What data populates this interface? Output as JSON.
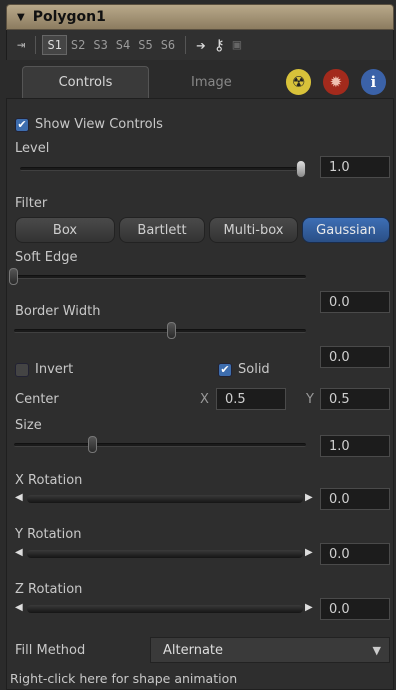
{
  "title": "Polygon1",
  "toolbar": {
    "slots": [
      "S1",
      "S2",
      "S3",
      "S4",
      "S5",
      "S6"
    ],
    "active_slot": "S1"
  },
  "tabs": {
    "controls": "Controls",
    "image": "Image"
  },
  "show_view_controls": {
    "label": "Show View Controls",
    "checked": true
  },
  "level": {
    "label": "Level",
    "value": "1.0",
    "fraction": 1.0
  },
  "filter": {
    "label": "Filter",
    "options": [
      "Box",
      "Bartlett",
      "Multi-box",
      "Gaussian"
    ],
    "selected": "Gaussian"
  },
  "soft_edge": {
    "label": "Soft Edge",
    "value": "0.0",
    "fraction": 0.0
  },
  "border_width": {
    "label": "Border Width",
    "value": "0.0",
    "fraction": 0.5
  },
  "invert": {
    "label": "Invert",
    "checked": false
  },
  "solid": {
    "label": "Solid",
    "checked": true
  },
  "center": {
    "label": "Center",
    "x_label": "X",
    "x_value": "0.5",
    "y_label": "Y",
    "y_value": "0.5"
  },
  "size": {
    "label": "Size",
    "value": "1.0",
    "fraction": 0.2
  },
  "x_rotation": {
    "label": "X Rotation",
    "value": "0.0"
  },
  "y_rotation": {
    "label": "Y Rotation",
    "value": "0.0"
  },
  "z_rotation": {
    "label": "Z Rotation",
    "value": "0.0"
  },
  "fill_method": {
    "label": "Fill Method",
    "value": "Alternate"
  },
  "status": "Right-click here for shape animation",
  "colors": {
    "accent": "#3d6eb5",
    "title_bar": "#a39373"
  }
}
